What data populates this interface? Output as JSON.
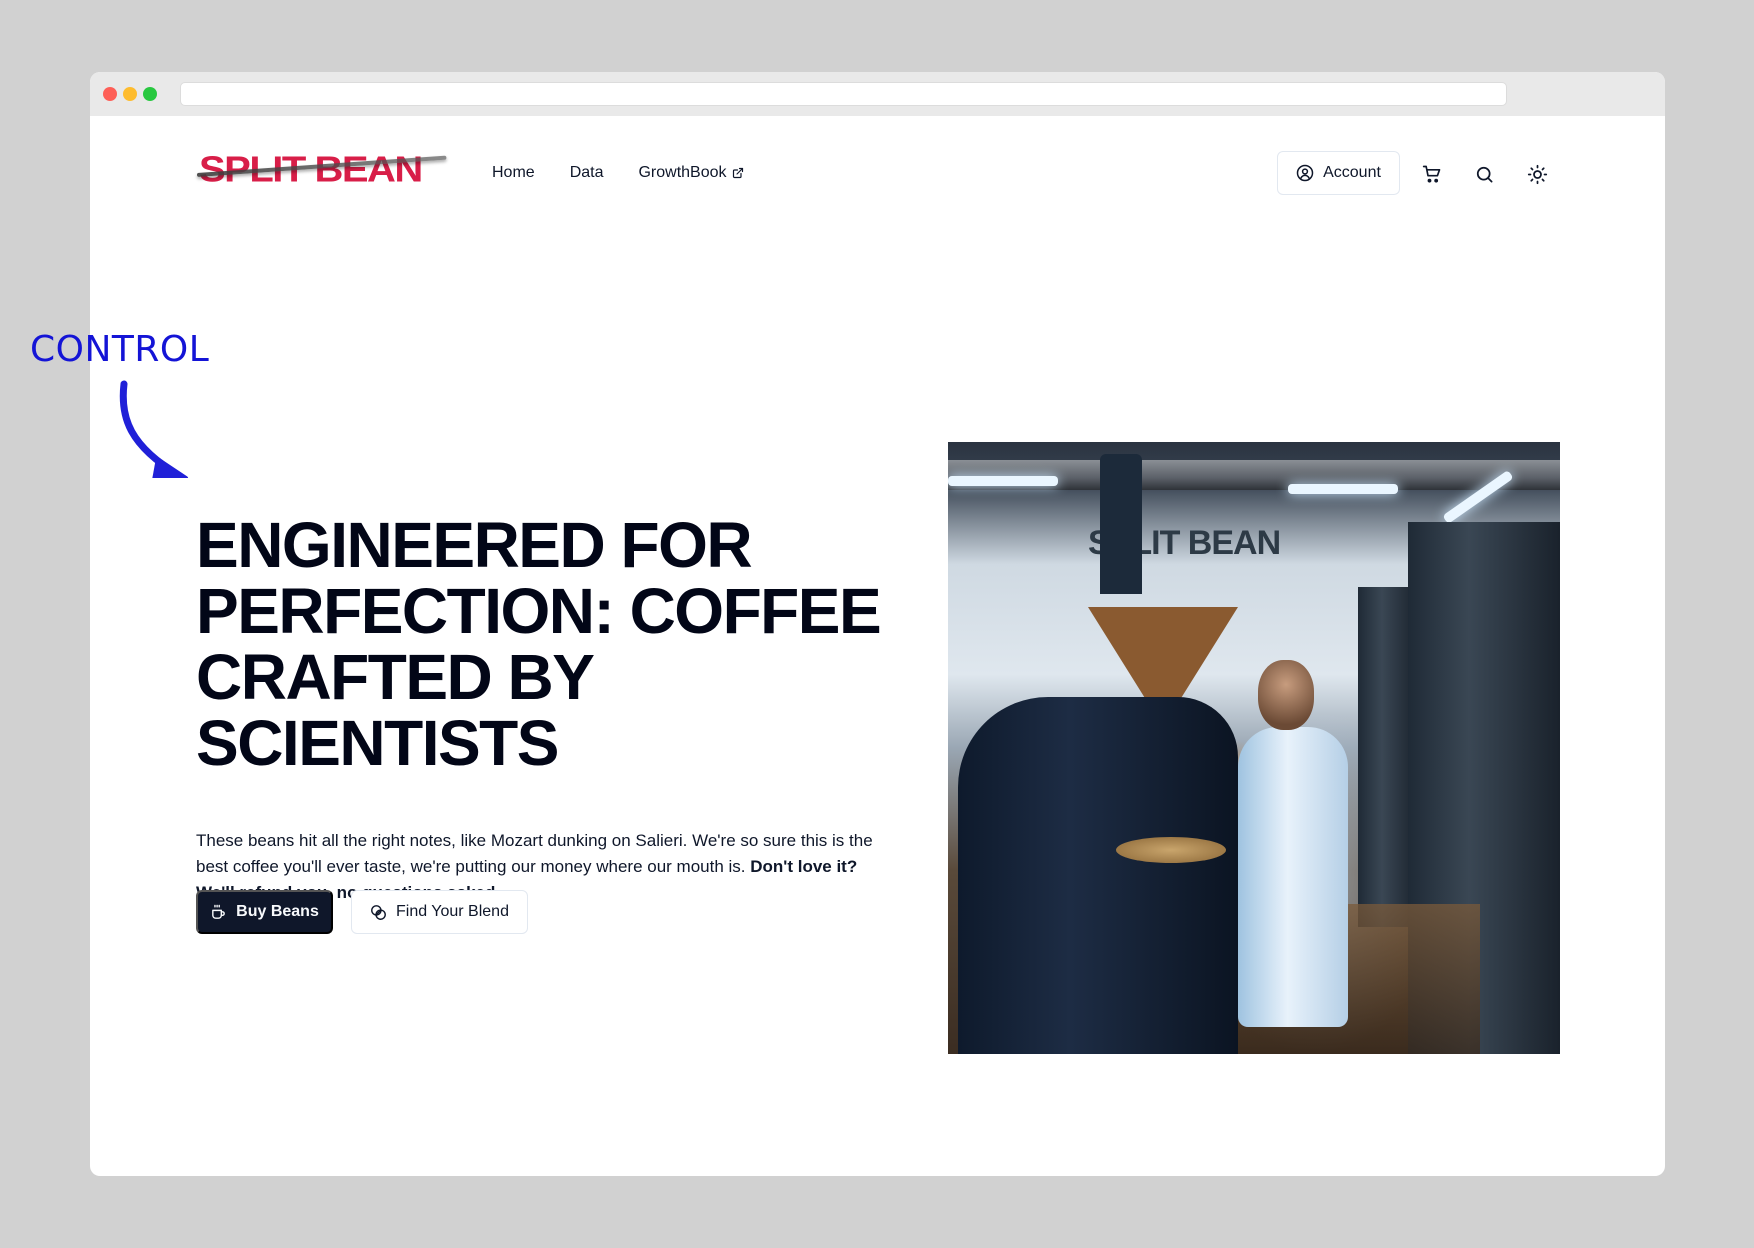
{
  "annotation": {
    "label": "CONTROL",
    "color": "#1414d6"
  },
  "browser": {
    "url": ""
  },
  "header": {
    "logo_text": "SPLIT BEAN",
    "nav": [
      {
        "label": "Home"
      },
      {
        "label": "Data"
      },
      {
        "label": "GrowthBook",
        "external": true
      }
    ],
    "account_label": "Account",
    "icons": [
      "user-circle-icon",
      "cart-icon",
      "search-icon",
      "sun-icon"
    ]
  },
  "hero": {
    "headline": "ENGINEERED FOR PERFECTION: COFFEE CRAFTED BY SCIENTISTS",
    "body_regular": "These beans hit all the right notes, like Mozart dunking on Salieri. We're so sure this is the best coffee you'll ever taste, we're putting our money where our mouth is. ",
    "body_bold": "Don't love it? We'll refund you, no questions asked.",
    "primary_button": "Buy Beans",
    "secondary_button": "Find Your Blend",
    "image_alt": "Scientist in a lab coat operating a coffee roaster in the Split Bean roastery",
    "image_sign_text": "SPLIT BEAN"
  },
  "colors": {
    "brand_red": "#d81e48",
    "primary_dark": "#0f172a",
    "headline": "#020617",
    "border": "#e2e8f0"
  }
}
